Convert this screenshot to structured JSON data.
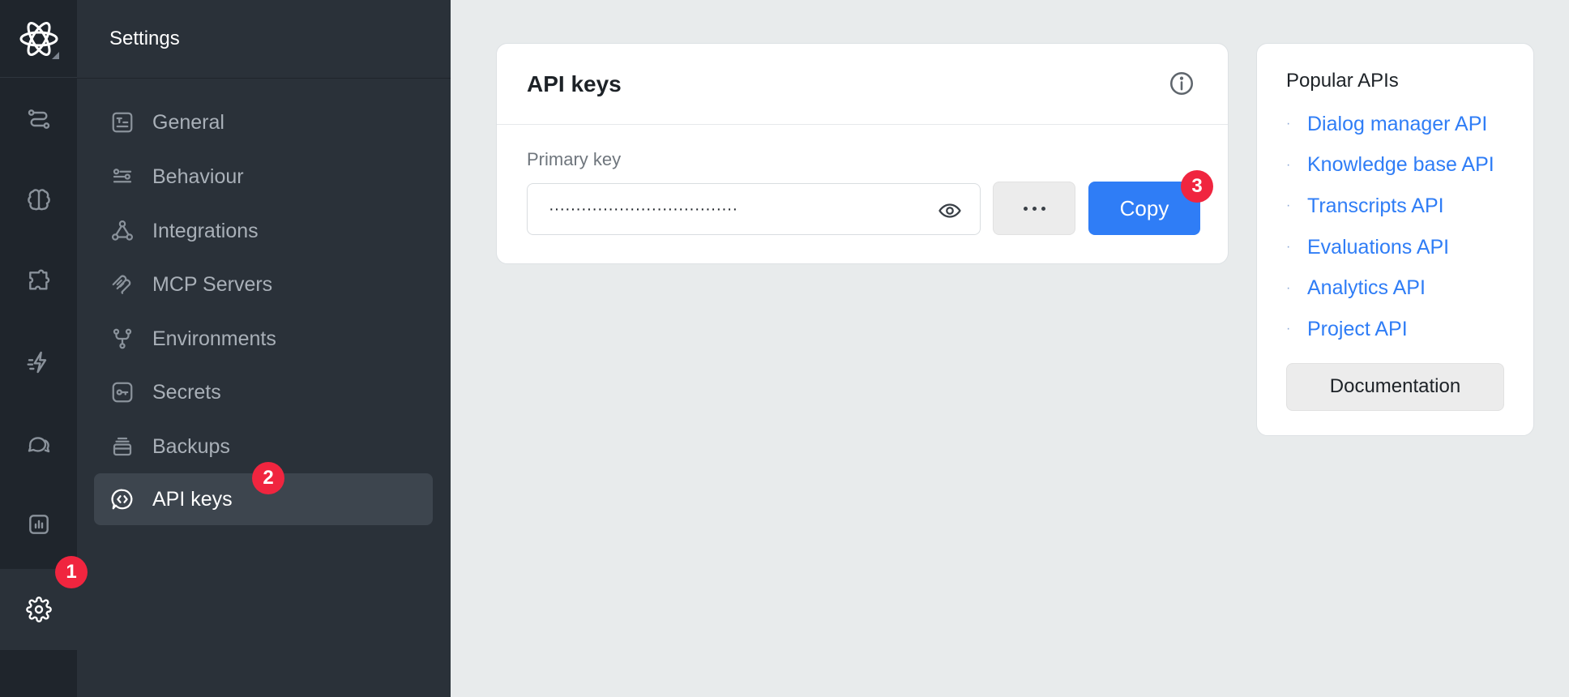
{
  "rail": {
    "items": [
      {
        "icon": "route-icon"
      },
      {
        "icon": "brain-icon"
      },
      {
        "icon": "puzzle-icon"
      },
      {
        "icon": "bolt-icon"
      },
      {
        "icon": "chat-icon"
      },
      {
        "icon": "chart-icon"
      },
      {
        "icon": "gear-icon",
        "active": true
      }
    ]
  },
  "settings": {
    "title": "Settings",
    "items": [
      {
        "label": "General",
        "icon": "general-icon"
      },
      {
        "label": "Behaviour",
        "icon": "sliders-icon"
      },
      {
        "label": "Integrations",
        "icon": "integrations-icon"
      },
      {
        "label": "MCP Servers",
        "icon": "mcp-icon"
      },
      {
        "label": "Environments",
        "icon": "branch-icon"
      },
      {
        "label": "Secrets",
        "icon": "key-icon"
      },
      {
        "label": "Backups",
        "icon": "backup-icon"
      },
      {
        "label": "API keys",
        "icon": "api-icon",
        "active": true
      }
    ]
  },
  "badges": {
    "one": "1",
    "two": "2",
    "three": "3"
  },
  "api_card": {
    "title": "API keys",
    "primary_label": "Primary key",
    "key_value": "···································",
    "copy_label": "Copy"
  },
  "popular": {
    "title": "Popular APIs",
    "links": [
      "Dialog manager API",
      "Knowledge base API",
      "Transcripts API",
      "Evaluations API",
      "Analytics API",
      "Project API"
    ],
    "doc_label": "Documentation"
  },
  "colors": {
    "accent": "#2f7df6",
    "badge": "#f0253f",
    "rail": "#1f252c",
    "panel": "#2a3139"
  }
}
